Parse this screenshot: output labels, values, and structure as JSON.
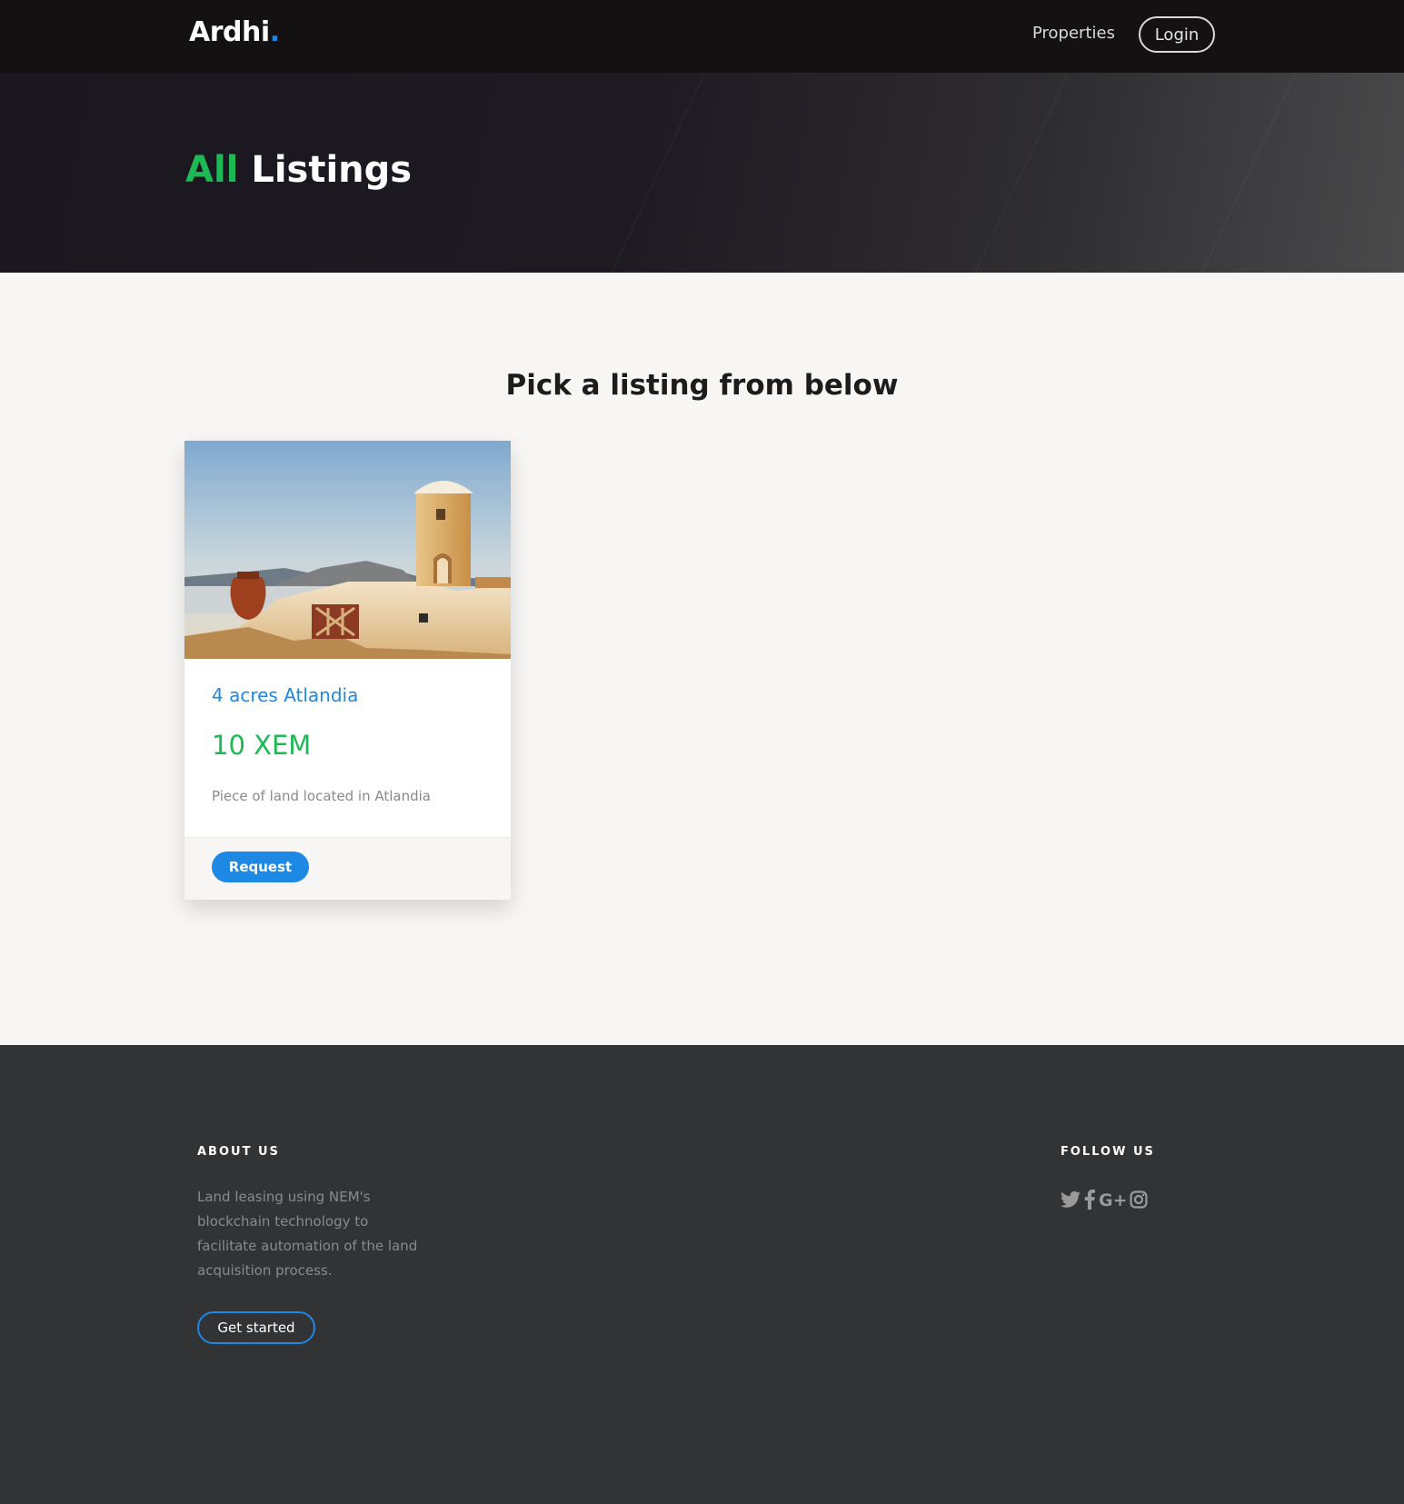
{
  "navbar": {
    "brand": "Ardhi",
    "brand_dot": ".",
    "links": [
      "Properties"
    ],
    "login_label": "Login"
  },
  "hero": {
    "title_accent": "All",
    "title_rest": "Listings"
  },
  "main": {
    "heading": "Pick a listing from below",
    "listings": [
      {
        "title": "4 acres Atlandia",
        "price": "10 XEM",
        "description": "Piece of land located in Atlandia",
        "action_label": "Request"
      }
    ]
  },
  "footer": {
    "about_heading": "ABOUT US",
    "about_text": "Land leasing using NEM's blockchain technology to facilitate automation of the land acquisition process.",
    "cta_label": "Get started",
    "follow_heading": "FOLLOW US",
    "social_icons": [
      "twitter-icon",
      "facebook-icon",
      "google-plus-icon",
      "instagram-icon"
    ]
  },
  "colors": {
    "accent_green": "#1db954",
    "accent_blue": "#1e88e5",
    "navbar_bg": "#141112",
    "footer_bg": "#323334",
    "page_bg": "#f7f6f4"
  }
}
